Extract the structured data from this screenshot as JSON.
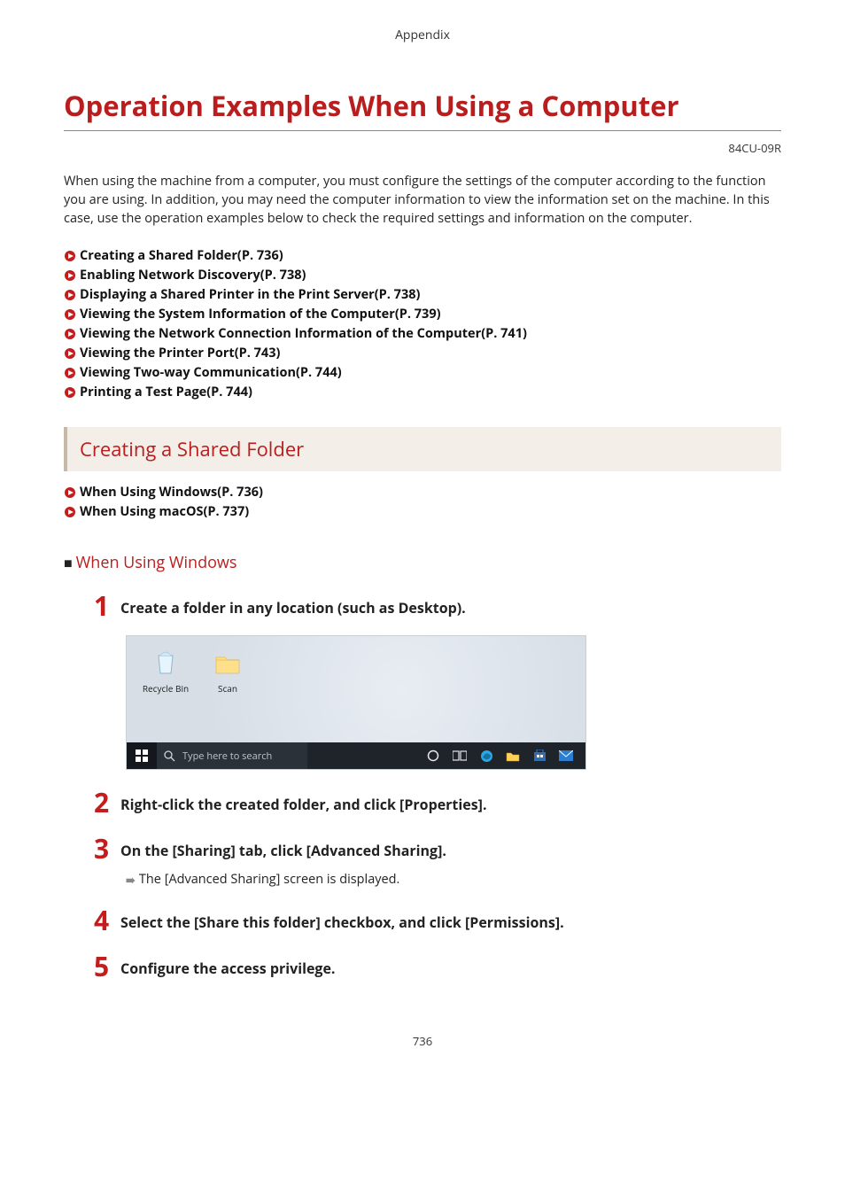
{
  "header": {
    "section": "Appendix"
  },
  "title": "Operation Examples When Using a Computer",
  "doc_code": "84CU-09R",
  "intro": "When using the machine from a computer, you must configure the settings of the computer according to the function you are using. In addition, you may need the computer information to view the information set on the machine. In this case, use the operation examples below to check the required settings and information on the computer.",
  "links": [
    "Creating a Shared Folder(P. 736)",
    "Enabling Network Discovery(P. 738)",
    "Displaying a Shared Printer in the Print Server(P. 738)",
    "Viewing the System Information of the Computer(P. 739)",
    "Viewing the Network Connection Information of the Computer(P. 741)",
    "Viewing the Printer Port(P. 743)",
    "Viewing Two-way Communication(P. 744)",
    "Printing a Test Page(P. 744)"
  ],
  "section1": {
    "heading": "Creating a Shared Folder"
  },
  "sub_links": [
    "When Using Windows(P. 736)",
    "When Using macOS(P. 737)"
  ],
  "subheading": "When Using Windows",
  "steps": {
    "s1": "Create a folder in any location (such as Desktop).",
    "s2": "Right-click the created folder, and click [Properties].",
    "s3": "On the [Sharing] tab, click [Advanced Sharing].",
    "s3_note": "The [Advanced Sharing] screen is displayed.",
    "s4": "Select the [Share this folder] checkbox, and click [Permissions].",
    "s5": "Configure the access privilege."
  },
  "desktop": {
    "recycle_label": "Recycle Bin",
    "scan_label": "Scan",
    "search_placeholder": "Type here to search"
  },
  "page_number": "736"
}
